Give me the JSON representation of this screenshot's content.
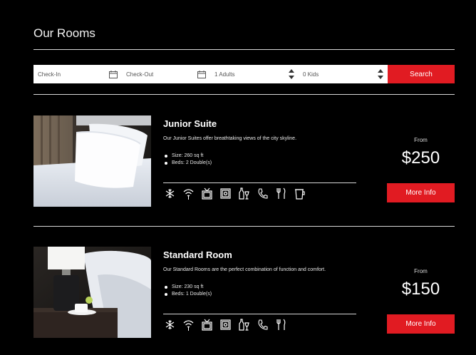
{
  "page": {
    "title": "Our Rooms"
  },
  "search": {
    "checkin_placeholder": "Check-In",
    "checkout_placeholder": "Check-Out",
    "adults_value": "1 Adults",
    "kids_value": "0 Kids",
    "button_label": "Search"
  },
  "accent_color": "#e11b22",
  "rooms": [
    {
      "name": "Junior Suite",
      "description": "Our Junior Suites offer breathtaking views of the city skyline.",
      "features": [
        "Size: 260 sq ft",
        "Beds: 2 Double(s)"
      ],
      "amenities": [
        "air-conditioning",
        "wifi",
        "tv",
        "safe",
        "minibar",
        "phone",
        "restaurant",
        "coffee"
      ],
      "from_label": "From",
      "price": "$250",
      "button_label": "More Info"
    },
    {
      "name": "Standard Room",
      "description": "Our Standard Rooms are the perfect combination of function and comfort.",
      "features": [
        "Size: 230 sq ft",
        "Beds: 1 Double(s)"
      ],
      "amenities": [
        "air-conditioning",
        "wifi",
        "tv",
        "safe",
        "minibar",
        "phone",
        "restaurant"
      ],
      "from_label": "From",
      "price": "$150",
      "button_label": "More Info"
    }
  ]
}
